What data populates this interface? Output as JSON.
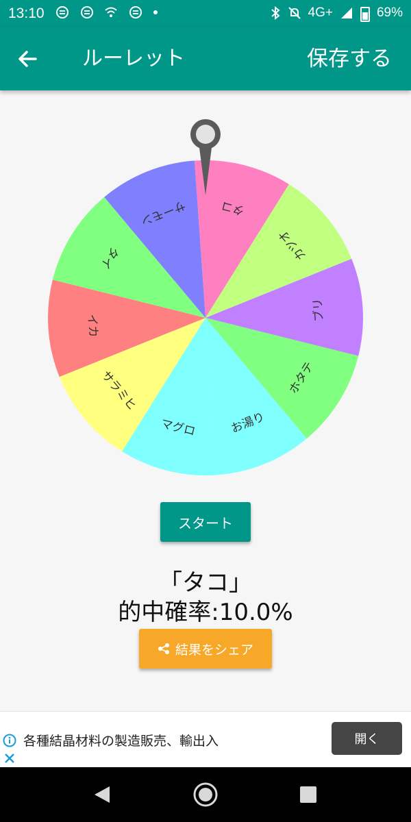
{
  "status_bar": {
    "time": "13:10",
    "network": "4G+",
    "battery": "69%",
    "left_icons": [
      "notification-icon",
      "notification-icon",
      "wifi-on-icon",
      "notification-icon",
      "dot-icon"
    ]
  },
  "app_bar": {
    "title": "ルーレット",
    "save_label": "保存する",
    "color": "#009688"
  },
  "roulette": {
    "segments": [
      {
        "label": "タコ",
        "color": "#ff80c0"
      },
      {
        "label": "カツオ",
        "color": "#c0ff80"
      },
      {
        "label": "ブリ",
        "color": "#c080ff"
      },
      {
        "label": "ホタテ",
        "color": "#80ff80"
      },
      {
        "label": "お湯り",
        "color": "#80ffff"
      },
      {
        "label": "マグロ",
        "color": "#80ffff"
      },
      {
        "label": "サラミヒ",
        "color": "#ffff80"
      },
      {
        "label": "イカ",
        "color": "#ff8080"
      },
      {
        "label": "タイ",
        "color": "#80ff80"
      },
      {
        "label": "サーモン",
        "color": "#8080ff"
      }
    ]
  },
  "start_label": "スタート",
  "result": {
    "name": "「タコ」",
    "rate": "的中確率:10.0%"
  },
  "share_label": "結果をシェア",
  "ad": {
    "text": "各種結晶材料の製造販売、輸出入",
    "button_label": "開く"
  }
}
